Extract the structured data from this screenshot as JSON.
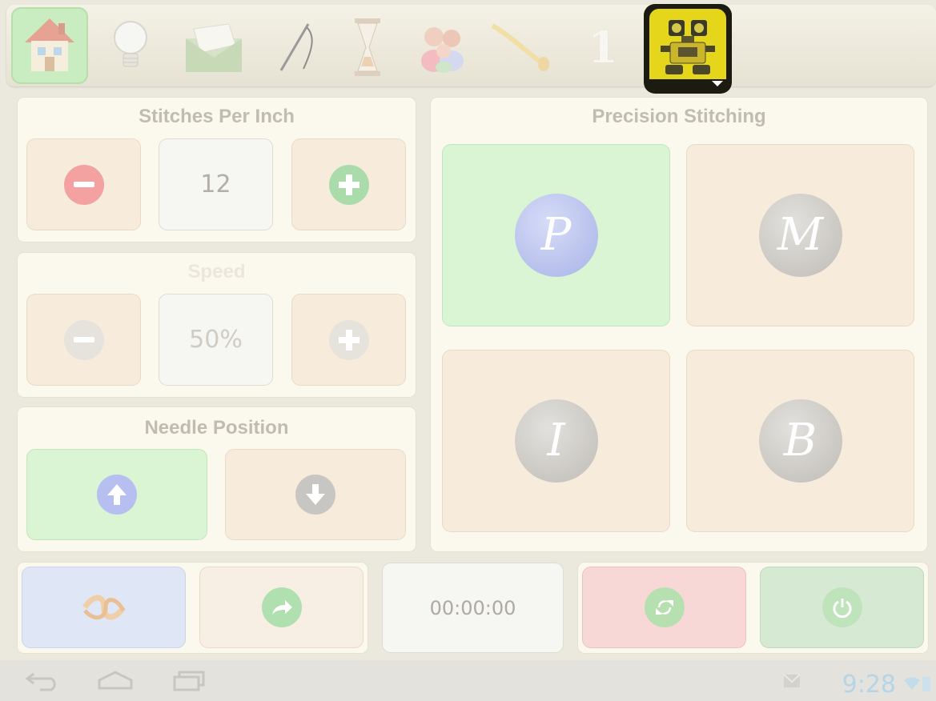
{
  "stitches": {
    "title": "Stitches Per Inch",
    "value": "12"
  },
  "speed": {
    "title": "Speed",
    "value": "50%"
  },
  "needle": {
    "title": "Needle Position"
  },
  "precision": {
    "title": "Precision Stitching",
    "modes": [
      {
        "letter": "P",
        "active": true
      },
      {
        "letter": "M",
        "active": false
      },
      {
        "letter": "I",
        "active": false
      },
      {
        "letter": "B",
        "active": false
      }
    ]
  },
  "timer": {
    "value": "00:00:00"
  },
  "toolbar": {
    "icons": [
      "home-icon",
      "lightbulb-icon",
      "envelope-icon",
      "needle-thread-icon",
      "hourglass-icon",
      "people-icon",
      "thread-icon",
      "one-icon",
      "robot-icon"
    ],
    "number_label": "1"
  },
  "status": {
    "time": "9:28"
  },
  "colors": {
    "accent": "#d9f5d3",
    "robot_bg": "#1b1b12",
    "clock": "#b6d4e8"
  }
}
